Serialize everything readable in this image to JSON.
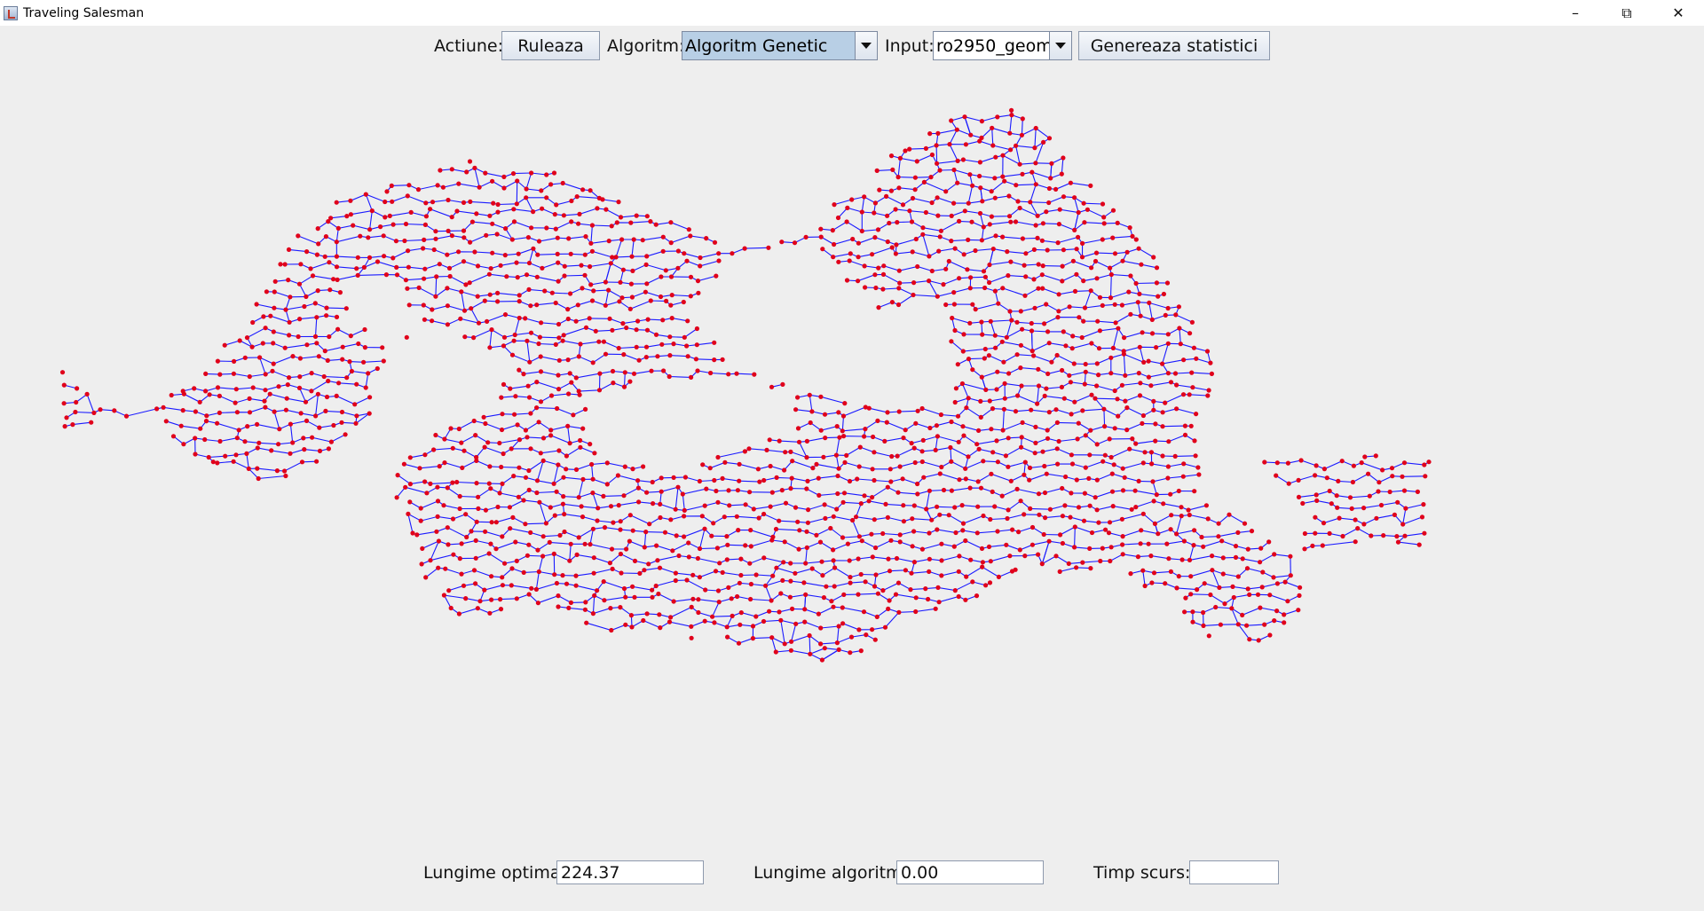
{
  "window": {
    "title": "Traveling Salesman",
    "icon": "java-cup-icon",
    "controls": [
      "minimize-icon",
      "restore-icon",
      "close-icon"
    ]
  },
  "toolbar": {
    "action_label": "Actiune:",
    "run_button": "Ruleaza",
    "algorithm_label": "Algoritm:",
    "algorithm_value": "Algoritm Genetic",
    "input_label": "Input:",
    "input_value": "ro2950_geom",
    "stats_button": "Genereaza statistici"
  },
  "map": {
    "description": "tour",
    "colors": {
      "edge": "#1a1aff",
      "city": "#e0001b"
    }
  },
  "status": {
    "optimal_label": "Lungime optima:",
    "optimal_value": "224.37",
    "algorithm_length_label": "Lungime algoritm:",
    "algorithm_length_value": "0.00",
    "time_label": "Timp scurs:",
    "time_value": ""
  }
}
